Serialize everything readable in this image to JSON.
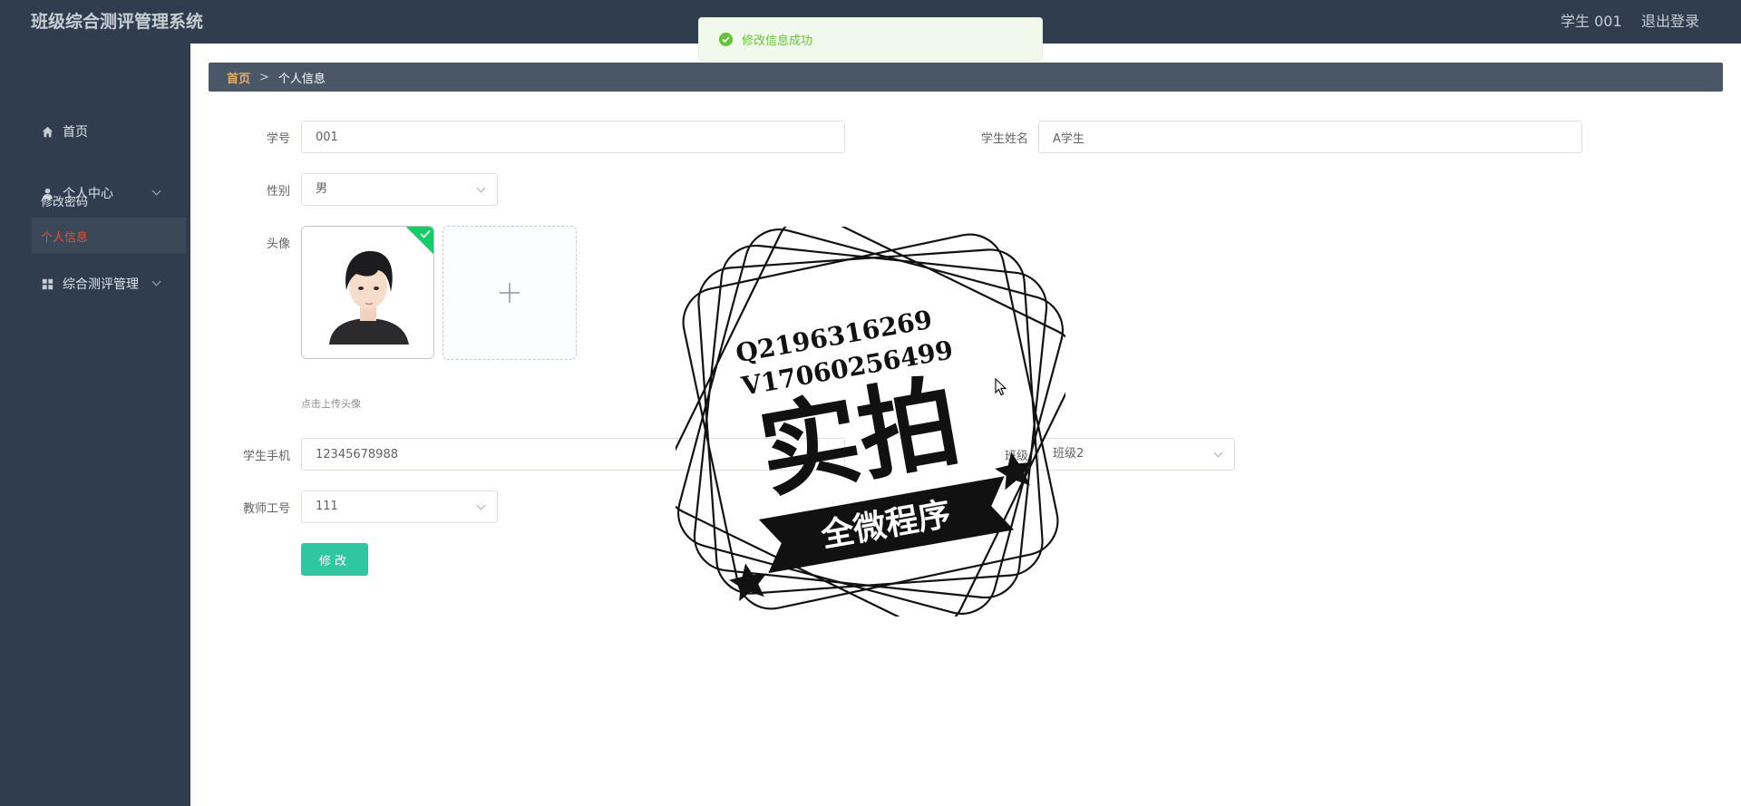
{
  "app": {
    "title": "班级综合测评管理系统"
  },
  "header": {
    "user": "学生 001",
    "logout": "退出登录"
  },
  "toast": {
    "message": "修改信息成功"
  },
  "sidebar": {
    "home": "首页",
    "personal_center": "个人中心",
    "change_password": "修改密码",
    "personal_info": "个人信息",
    "evaluation_management": "综合测评管理"
  },
  "breadcrumb": {
    "home": "首页",
    "separator": ">",
    "current": "个人信息"
  },
  "form": {
    "student_id_label": "学号",
    "student_id_value": "001",
    "student_name_label": "学生姓名",
    "student_name_value": "A学生",
    "gender_label": "性别",
    "gender_value": "男",
    "avatar_label": "头像",
    "upload_hint": "点击上传头像",
    "phone_label": "学生手机",
    "phone_value": "12345678988",
    "class_label": "班级",
    "class_value": "班级2",
    "teacher_id_label": "教师工号",
    "teacher_id_value": "111",
    "submit_label": "修改"
  },
  "watermark": {
    "line1": "Q2196316269",
    "line2": "V17060256499",
    "main": "实拍",
    "banner": "全微程序"
  },
  "colors": {
    "sidebar_bg": "#2f3d4e",
    "active_menu": "#e8512c",
    "breadcrumb_home": "#e8ad62",
    "primary_button": "#2fc6a0",
    "success": "#67c23a"
  },
  "icons": [
    "home-icon",
    "user-icon",
    "grid-icon",
    "chevron-down-icon",
    "plus-icon",
    "check-icon",
    "success-icon"
  ]
}
